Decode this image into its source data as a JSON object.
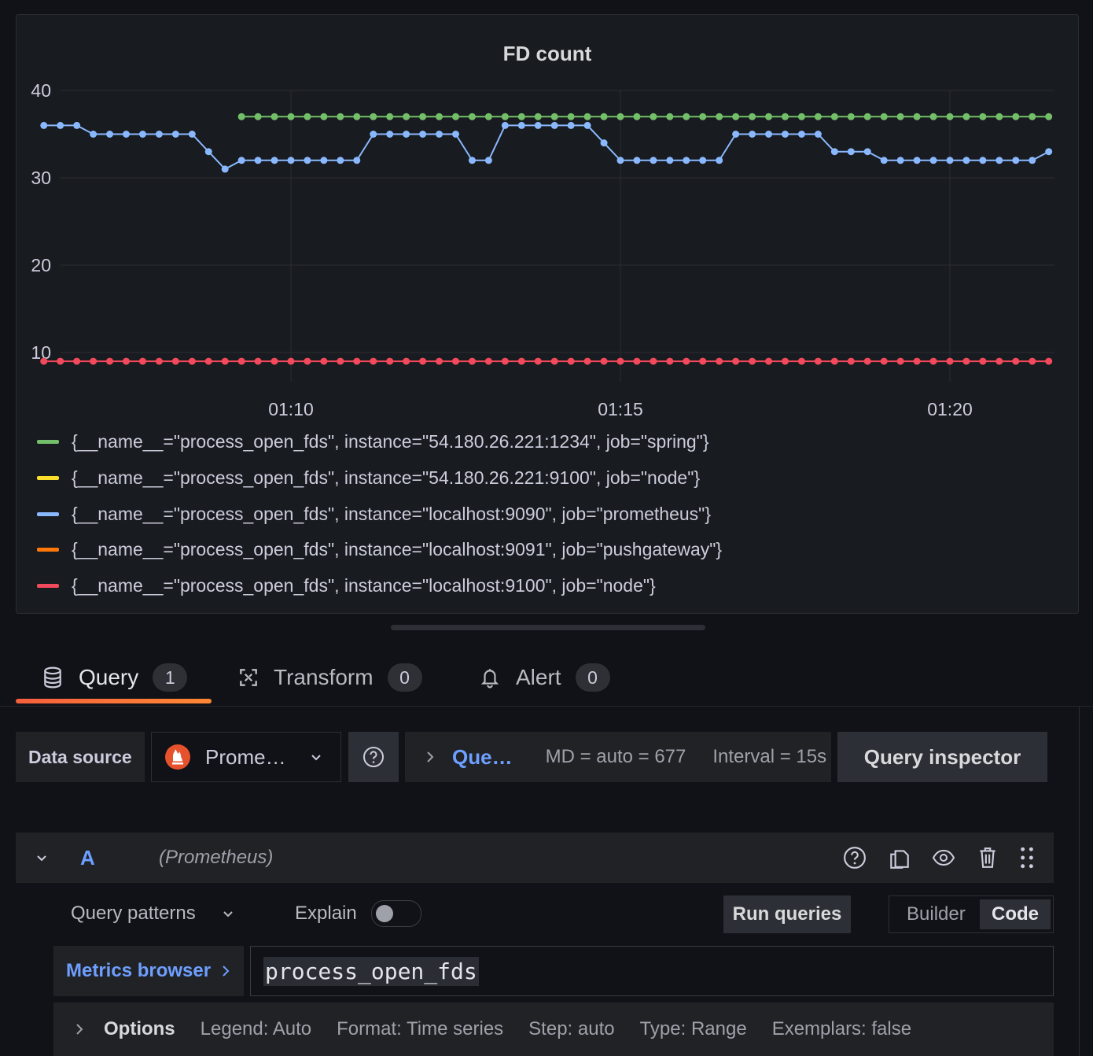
{
  "panel": {
    "title": "FD count"
  },
  "chart_data": {
    "type": "line",
    "title": "FD count",
    "xlabel": "",
    "ylabel": "",
    "ylim": [
      5,
      42
    ],
    "xlim": [
      "01:06:15",
      "01:21:30"
    ],
    "y_ticks": [
      "10",
      "20",
      "30",
      "40"
    ],
    "x_ticks": [
      "01:10",
      "01:15",
      "01:20"
    ],
    "grid": true,
    "legend_position": "bottom",
    "series": [
      {
        "name": "{__name__=\"process_open_fds\", instance=\"54.180.26.221:1234\", job=\"spring\"}",
        "color": "#73bf69",
        "x": [
          "01:09:15",
          "01:21:30"
        ],
        "values": [
          37,
          37
        ],
        "sample_interval": "15s"
      },
      {
        "name": "{__name__=\"process_open_fds\", instance=\"54.180.26.221:9100\", job=\"node\"}",
        "color": "#fade2a",
        "x": [],
        "values": []
      },
      {
        "name": "{__name__=\"process_open_fds\", instance=\"localhost:9090\", job=\"prometheus\"}",
        "color": "#8ab8ff",
        "x": [
          "01:06:15",
          "01:06:30",
          "01:06:45",
          "01:07:00",
          "01:07:15",
          "01:07:30",
          "01:07:45",
          "01:08:00",
          "01:08:15",
          "01:08:30",
          "01:08:45",
          "01:09:00",
          "01:09:15",
          "01:09:30",
          "01:09:45",
          "01:10:00",
          "01:10:15",
          "01:10:30",
          "01:10:45",
          "01:11:00",
          "01:11:15",
          "01:11:30",
          "01:11:45",
          "01:12:00",
          "01:12:15",
          "01:12:30",
          "01:12:45",
          "01:13:00",
          "01:13:15",
          "01:13:30",
          "01:13:45",
          "01:14:00",
          "01:14:15",
          "01:14:30",
          "01:14:45",
          "01:15:00",
          "01:15:15",
          "01:15:30",
          "01:15:45",
          "01:16:00",
          "01:16:15",
          "01:16:30",
          "01:16:45",
          "01:17:00",
          "01:17:15",
          "01:17:30",
          "01:17:45",
          "01:18:00",
          "01:18:15",
          "01:18:30",
          "01:18:45",
          "01:19:00",
          "01:19:15",
          "01:19:30",
          "01:19:45",
          "01:20:00",
          "01:20:15",
          "01:20:30",
          "01:20:45",
          "01:21:00",
          "01:21:15",
          "01:21:30"
        ],
        "values": [
          36,
          36,
          36,
          35,
          35,
          35,
          35,
          35,
          35,
          35,
          33,
          31,
          32,
          32,
          32,
          32,
          32,
          32,
          32,
          32,
          35,
          35,
          35,
          35,
          35,
          35,
          32,
          32,
          36,
          36,
          36,
          36,
          36,
          36,
          34,
          32,
          32,
          32,
          32,
          32,
          32,
          32,
          35,
          35,
          35,
          35,
          35,
          35,
          33,
          33,
          33,
          32,
          32,
          32,
          32,
          32,
          32,
          32,
          32,
          32,
          32,
          33
        ]
      },
      {
        "name": "{__name__=\"process_open_fds\", instance=\"localhost:9091\", job=\"pushgateway\"}",
        "color": "#ff780a",
        "x": [],
        "values": []
      },
      {
        "name": "{__name__=\"process_open_fds\", instance=\"localhost:9100\", job=\"node\"}",
        "color": "#f2495c",
        "x": [
          "01:06:15",
          "01:21:30"
        ],
        "values": [
          9,
          9
        ],
        "sample_interval": "15s"
      }
    ]
  },
  "tabs": [
    {
      "label": "Query",
      "count": "1",
      "icon": "database-icon",
      "active": true
    },
    {
      "label": "Transform",
      "count": "0",
      "icon": "transform-icon",
      "active": false
    },
    {
      "label": "Alert",
      "count": "0",
      "icon": "bell-icon",
      "active": false
    }
  ],
  "toolbar": {
    "datasource_label": "Data source",
    "datasource_value": "Prome…",
    "query_options_label": "Que…",
    "md_text": "MD = auto = 677",
    "interval_text": "Interval = 15s",
    "query_inspector_label": "Query inspector"
  },
  "query_row": {
    "ref_id": "A",
    "datasource_name": "(Prometheus)"
  },
  "query_editor": {
    "patterns_label": "Query patterns",
    "explain_label": "Explain",
    "explain_on": false,
    "run_label": "Run queries",
    "mode_builder": "Builder",
    "mode_code": "Code",
    "mode_selected": "Code",
    "metrics_browser_label": "Metrics browser",
    "query_text": "process_open_fds"
  },
  "options": {
    "label": "Options",
    "legend": "Legend: Auto",
    "format": "Format: Time series",
    "step": "Step: auto",
    "type": "Type: Range",
    "exemplars": "Exemplars: false"
  },
  "colors": {
    "accent_blue": "#6e9fff",
    "tab_underline": "#ff7a3e",
    "prometheus_logo": "#e6522c"
  }
}
